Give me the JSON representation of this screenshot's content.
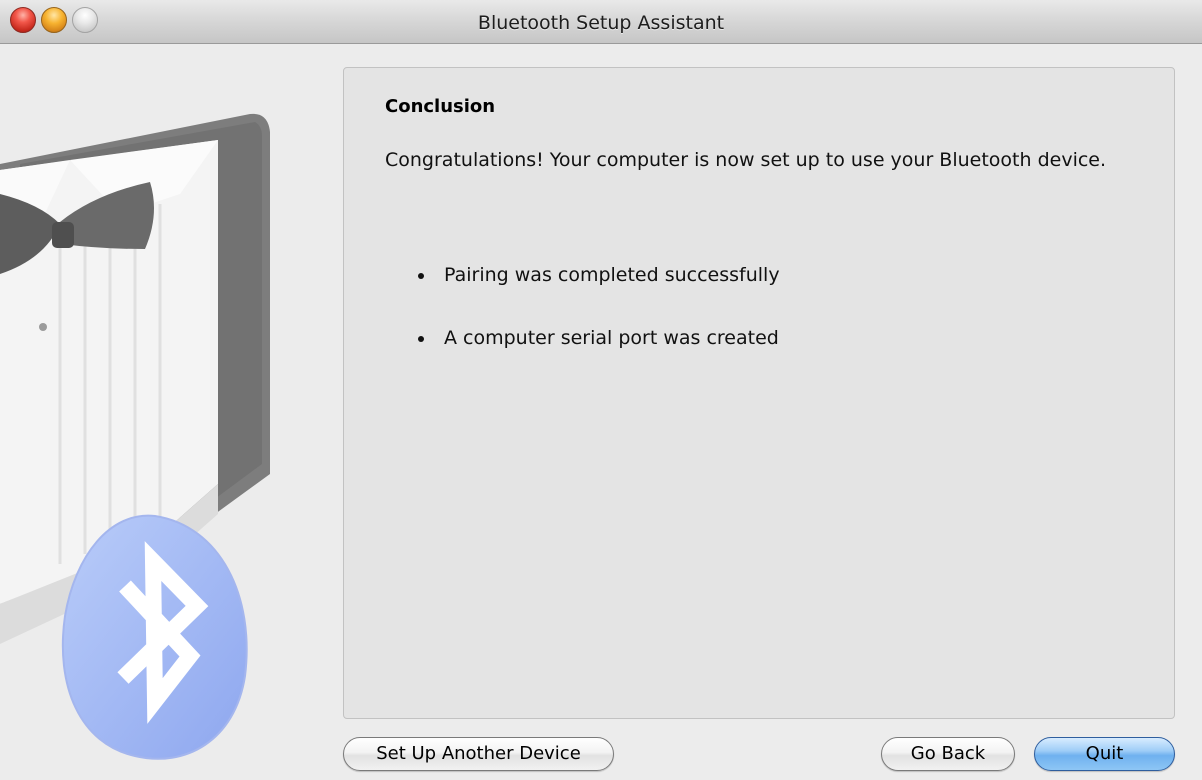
{
  "window": {
    "title": "Bluetooth Setup Assistant"
  },
  "content": {
    "heading": "Conclusion",
    "message": "Congratulations! Your computer is now set up to use your Bluetooth device.",
    "bullets": [
      "Pairing was completed successfully",
      "A computer serial port was created"
    ]
  },
  "buttons": {
    "setup_another": "Set Up Another Device",
    "go_back": "Go Back",
    "quit": "Quit"
  },
  "icons": {
    "close": "close-icon",
    "minimize": "minimize-icon",
    "zoom": "zoom-icon",
    "bluetooth": "bluetooth-icon"
  },
  "colors": {
    "default_button": "#8ec6f5",
    "bluetooth_badge": "#a9bff6"
  }
}
